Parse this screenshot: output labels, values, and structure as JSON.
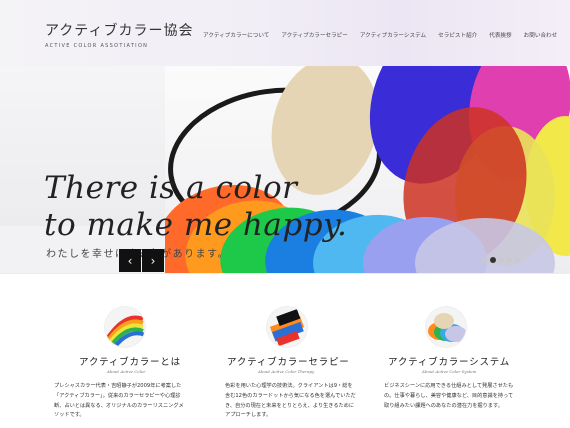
{
  "header": {
    "logo_title": "アクティブカラー協会",
    "logo_subtitle": "ACTIVE COLOR ASSOTIATION",
    "nav": [
      "アクティブカラーについて",
      "アクティブカラーセラピー",
      "アクティブカラーシステム",
      "セラピスト紹介",
      "代表挨拶",
      "お問い合わせ"
    ]
  },
  "hero": {
    "headline_line1": "There is a color",
    "headline_line2": "to make me happy.",
    "tagline": "わたしを幸せにする色があります。",
    "prev_label": "‹",
    "next_label": "›",
    "slide_count": 5,
    "active_slide": 2
  },
  "services": [
    {
      "title": "アクティブカラーとは",
      "subtitle": "About Active Color",
      "body": "プレシャスカラー代表・吉昭静子が2009年に考案した「アクティブカラー」。従来のカラーセラピーや心理診断、占いとは異なる、オリジナルのカラーリスニングメソッドです。",
      "icon": "rainbow-ribbon-icon"
    },
    {
      "title": "アクティブカラーセラピー",
      "subtitle": "About Active Color Therapy",
      "body": "色彩を用いた心理学の技術法。クライアントは9・総を含む12色のカラードットから気になる色を選んでいただき、自分の現在と未来をとりとらえ、より生きるためにアプローチします。",
      "icon": "color-swatch-icon"
    },
    {
      "title": "アクティブカラーシステム",
      "subtitle": "About Active Color System",
      "body": "ビジネスシーンに応用できる仕組みとして発展させたもの。仕事や暮らし、美容や健康など、目的意識を持って取り組みたい課題へのあなたの潜在力を掘ります。",
      "icon": "color-discs-icon"
    }
  ],
  "colors": {
    "accent_dark": "#111111",
    "header_tint": "#ece6f4"
  }
}
